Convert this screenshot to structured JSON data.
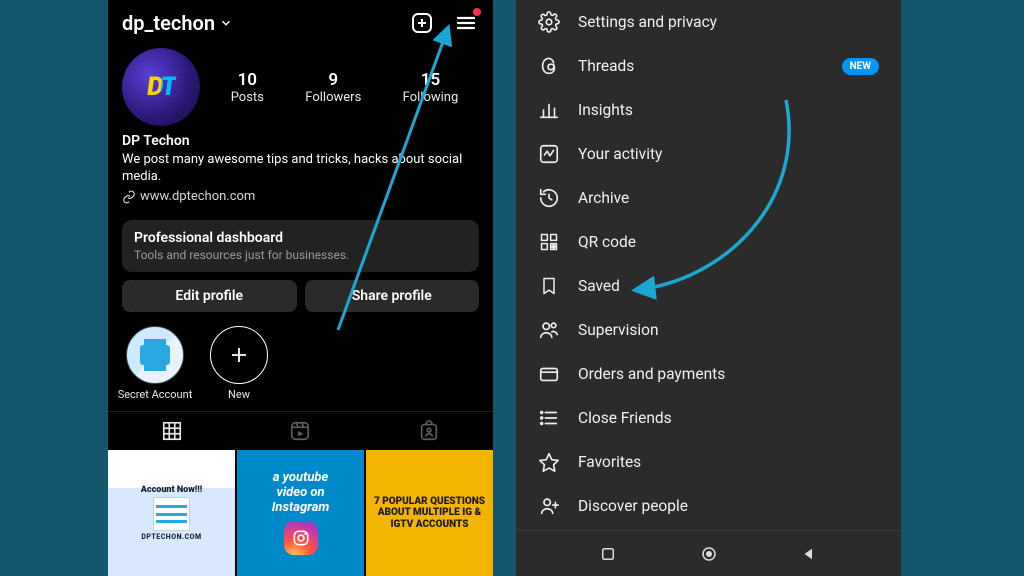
{
  "profile": {
    "username": "dp_techon",
    "stats": {
      "posts": {
        "count": "10",
        "label": "Posts"
      },
      "followers": {
        "count": "9",
        "label": "Followers"
      },
      "following": {
        "count": "15",
        "label": "Following"
      }
    },
    "display_name": "DP Techon",
    "bio_text": "We post many awesome tips and tricks, hacks about social media.",
    "website": "www.dptechon.com",
    "pro_dashboard": {
      "title": "Professional dashboard",
      "subtitle": "Tools and resources just for businesses."
    },
    "buttons": {
      "edit": "Edit profile",
      "share": "Share profile"
    },
    "highlights": [
      {
        "label": "Secret Account"
      },
      {
        "label": "New"
      }
    ],
    "posts": [
      {
        "headline": "Account Now!!!",
        "footer": "DPTECHON.COM"
      },
      {
        "line1": "a youtube",
        "line2": "video on",
        "line3": "Instagram"
      },
      {
        "text": "7 POPULAR QUESTIONS ABOUT MULTIPLE IG & IGTV ACCOUNTS"
      }
    ]
  },
  "menu": {
    "new_badge": "NEW",
    "items": [
      {
        "icon": "gear-icon",
        "label": "Settings and privacy",
        "badge": false
      },
      {
        "icon": "threads-icon",
        "label": "Threads",
        "badge": true
      },
      {
        "icon": "insights-icon",
        "label": "Insights",
        "badge": false
      },
      {
        "icon": "activity-icon",
        "label": "Your activity",
        "badge": false
      },
      {
        "icon": "archive-icon",
        "label": "Archive",
        "badge": false
      },
      {
        "icon": "qr-icon",
        "label": "QR code",
        "badge": false
      },
      {
        "icon": "saved-icon",
        "label": "Saved",
        "badge": false
      },
      {
        "icon": "supervision-icon",
        "label": "Supervision",
        "badge": false
      },
      {
        "icon": "payments-icon",
        "label": "Orders and payments",
        "badge": false
      },
      {
        "icon": "closefriends-icon",
        "label": "Close Friends",
        "badge": false
      },
      {
        "icon": "favorites-icon",
        "label": "Favorites",
        "badge": false
      },
      {
        "icon": "discover-icon",
        "label": "Discover people",
        "badge": false
      }
    ]
  },
  "colors": {
    "annotation": "#1aa7d4",
    "badge_blue": "#0095f6",
    "accent_red": "#ff2e4d"
  }
}
